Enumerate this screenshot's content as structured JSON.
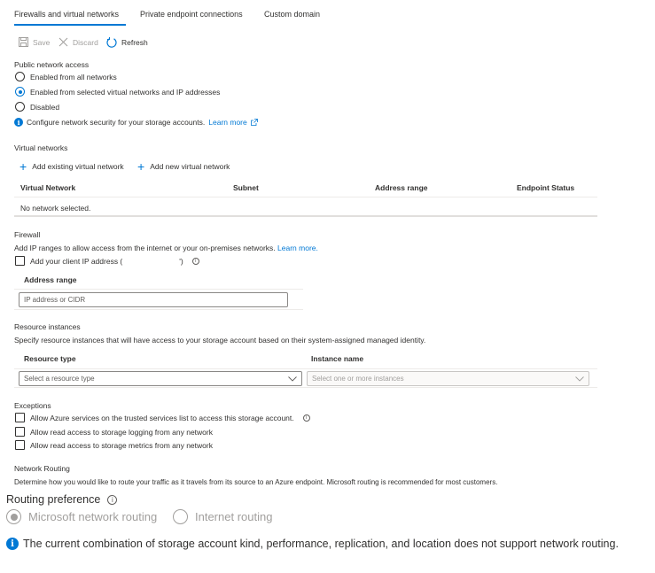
{
  "tabs": [
    {
      "label": "Firewalls and virtual networks",
      "active": true
    },
    {
      "label": "Private endpoint connections",
      "active": false
    },
    {
      "label": "Custom domain",
      "active": false
    }
  ],
  "toolbar": {
    "save_label": "Save",
    "discard_label": "Discard",
    "refresh_label": "Refresh"
  },
  "public_network_access": {
    "label": "Public network access",
    "options": [
      {
        "label": "Enabled from all networks",
        "selected": false
      },
      {
        "label": "Enabled from selected virtual networks and IP addresses",
        "selected": true
      },
      {
        "label": "Disabled",
        "selected": false
      }
    ],
    "info_text": "Configure network security for your storage accounts.",
    "learn_more": "Learn more"
  },
  "virtual_networks": {
    "label": "Virtual networks",
    "add_existing": "Add existing virtual network",
    "add_new": "Add new virtual network",
    "columns": [
      "Virtual Network",
      "Subnet",
      "Address range",
      "Endpoint Status"
    ],
    "empty_text": "No network selected."
  },
  "firewall": {
    "label": "Firewall",
    "description": "Add IP ranges to allow access from the internet or your on-premises networks.",
    "learn_more": "Learn more.",
    "client_ip_label": "Add your client IP address (",
    "client_ip_suffix": "')",
    "client_ip_checked": false,
    "address_range_header": "Address range",
    "address_placeholder": "IP address or CIDR"
  },
  "resource_instances": {
    "label": "Resource instances",
    "description": "Specify resource instances that will have access to your storage account based on their system-assigned managed identity.",
    "columns": [
      "Resource type",
      "Instance name"
    ],
    "resource_type_placeholder": "Select a resource type",
    "instance_placeholder": "Select one or more instances"
  },
  "exceptions": {
    "label": "Exceptions",
    "items": [
      {
        "label": "Allow Azure services on the trusted services list to access this storage account.",
        "checked": false,
        "info": true
      },
      {
        "label": "Allow read access to storage logging from any network",
        "checked": false,
        "info": false
      },
      {
        "label": "Allow read access to storage metrics from any network",
        "checked": false,
        "info": false
      }
    ]
  },
  "network_routing": {
    "label": "Network Routing",
    "description": "Determine how you would like to route your traffic as it travels from its source to an Azure endpoint. Microsoft routing is recommended for most customers.",
    "preference_label": "Routing preference",
    "options": [
      {
        "label": "Microsoft network routing",
        "selected": true
      },
      {
        "label": "Internet routing",
        "selected": false
      }
    ],
    "notice": "The current combination of storage account kind, performance, replication, and location does not support network routing."
  },
  "colors": {
    "accent": "#0078d4",
    "text": "#323130",
    "disabled": "#a19f9d"
  }
}
